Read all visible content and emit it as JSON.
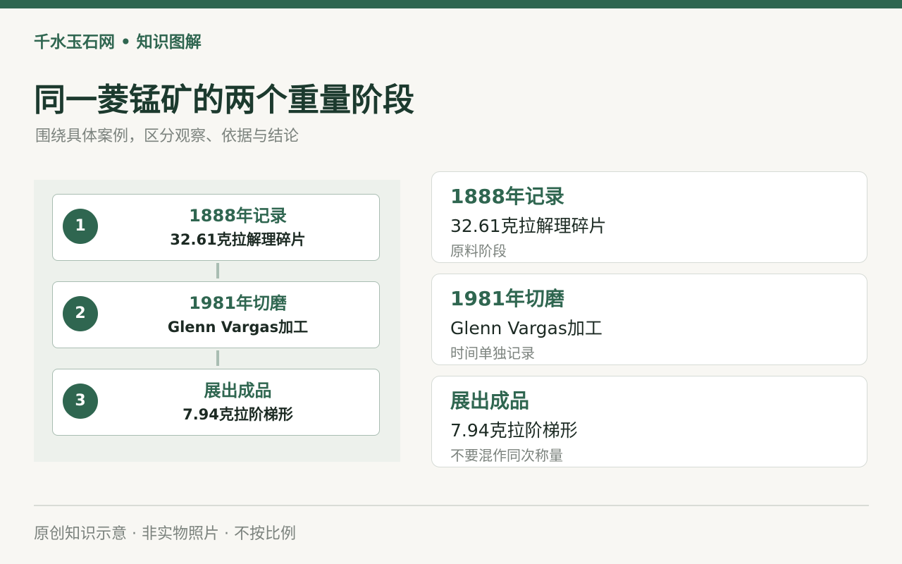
{
  "header": {
    "brand": "千水玉石网 • 知识图解",
    "title": "同一菱锰矿的两个重量阶段",
    "subtitle": "围绕具体案例，区分观察、依据与结论"
  },
  "flow": {
    "steps": [
      {
        "number": "1",
        "title": "1888年记录",
        "detail": "32.61克拉解理碎片"
      },
      {
        "number": "2",
        "title": "1981年切磨",
        "detail": "Glenn Vargas加工"
      },
      {
        "number": "3",
        "title": "展出成品",
        "detail": "7.94克拉阶梯形"
      }
    ]
  },
  "cards": [
    {
      "title": "1888年记录",
      "detail": "32.61克拉解理碎片",
      "note": "原料阶段"
    },
    {
      "title": "1981年切磨",
      "detail": "Glenn Vargas加工",
      "note": "时间单独记录"
    },
    {
      "title": "展出成品",
      "detail": "7.94克拉阶梯形",
      "note": "不要混作同次称量"
    }
  ],
  "footer": {
    "text": "原创知识示意 · 非实物照片 · 不按比例"
  },
  "colors": {
    "accent": "#2f6650",
    "panel": "#edf1ec",
    "background": "#f8f7f3",
    "muted_text": "#7c837e"
  }
}
